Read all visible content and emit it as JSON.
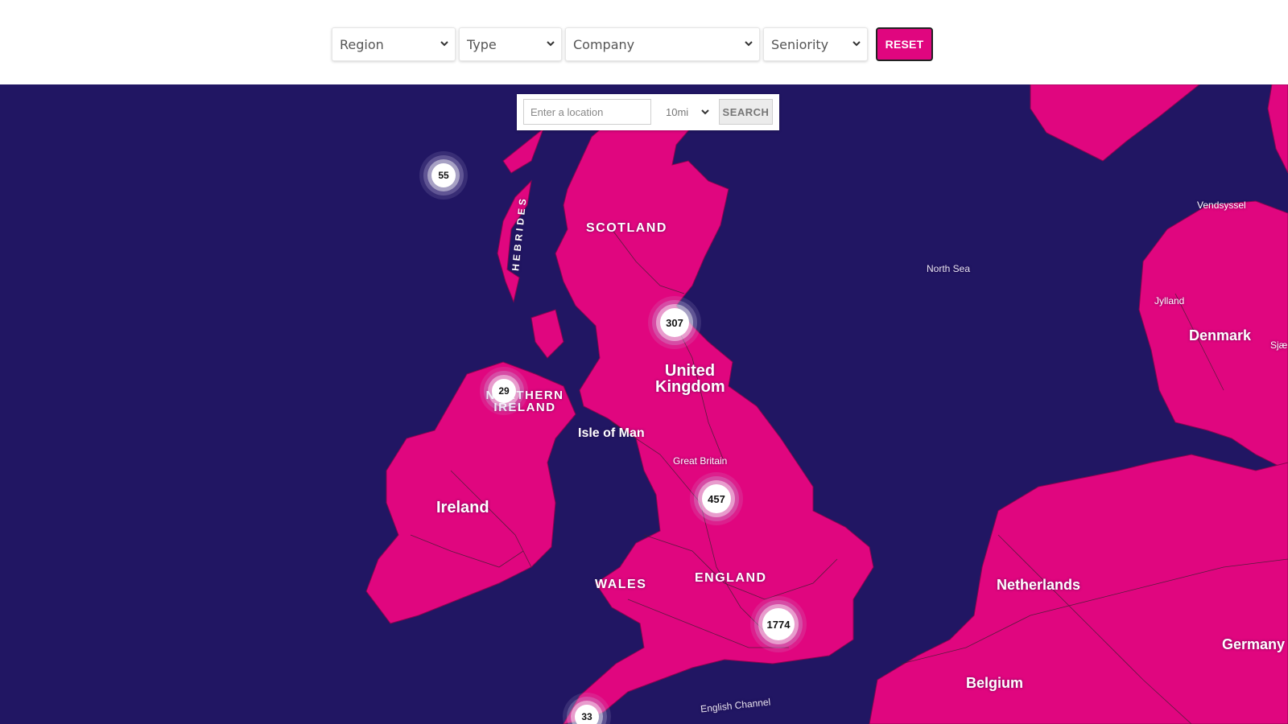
{
  "filters": {
    "region": "Region",
    "type": "Type",
    "company": "Company",
    "seniority": "Seniority",
    "reset_label": "RESET"
  },
  "search": {
    "placeholder": "Enter a location",
    "radius": "10mi",
    "button_label": "SEARCH"
  },
  "map": {
    "colors": {
      "sea": "#211663",
      "land": "#e0067f",
      "roads": "#3b2030",
      "accent": "#e0067f"
    },
    "labels": {
      "scotland": "SCOTLAND",
      "hebrides": "HEBRIDES",
      "united_kingdom": "United Kingdom",
      "northern_ireland": "NORTHERN IRELAND",
      "isle_of_man": "Isle of Man",
      "ireland": "Ireland",
      "great_britain": "Great Britain",
      "wales": "WALES",
      "england": "ENGLAND",
      "north_sea": "North Sea",
      "english_channel": "English Channel",
      "denmark": "Denmark",
      "jylland": "Jylland",
      "vendsyssel": "Vendsyssel",
      "sjaelland": "Sjæ",
      "netherlands": "Netherlands",
      "belgium": "Belgium",
      "germany": "Germany"
    },
    "clusters": [
      "55",
      "307",
      "29",
      "457",
      "1774",
      "33"
    ]
  }
}
